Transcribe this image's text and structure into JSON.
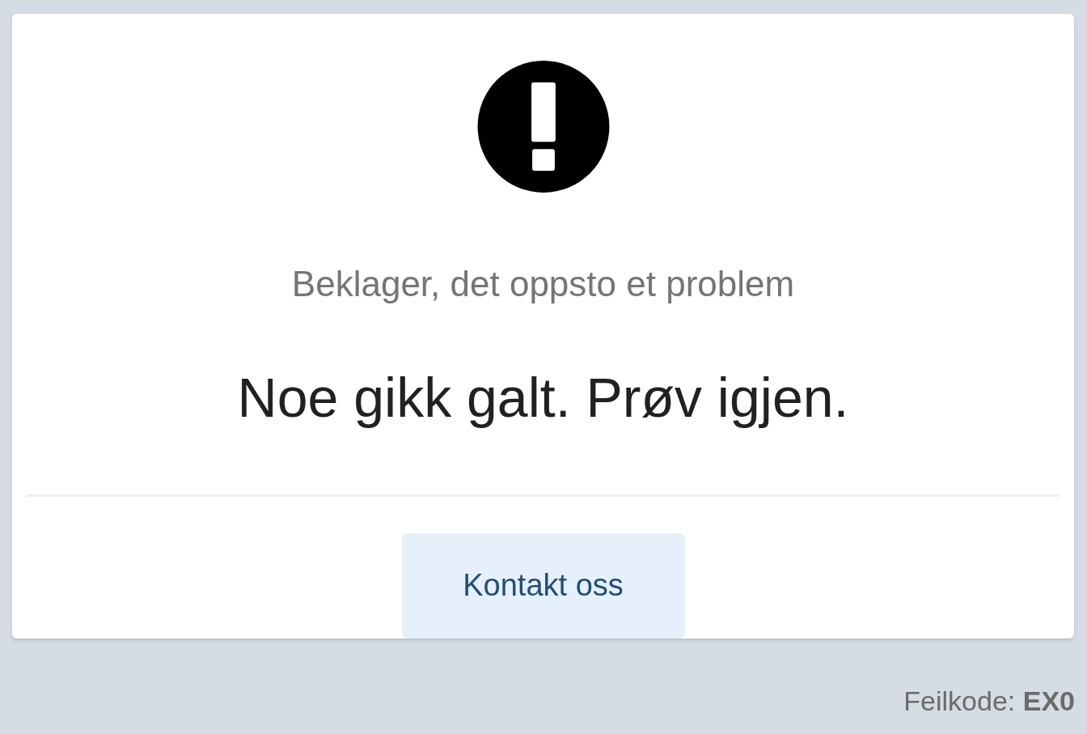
{
  "subtitle": "Beklager, det oppsto et problem",
  "heading": "Noe gikk galt. Prøv igjen.",
  "button": {
    "label": "Kontakt oss"
  },
  "footer": "Feilkode: **EX0**"
}
